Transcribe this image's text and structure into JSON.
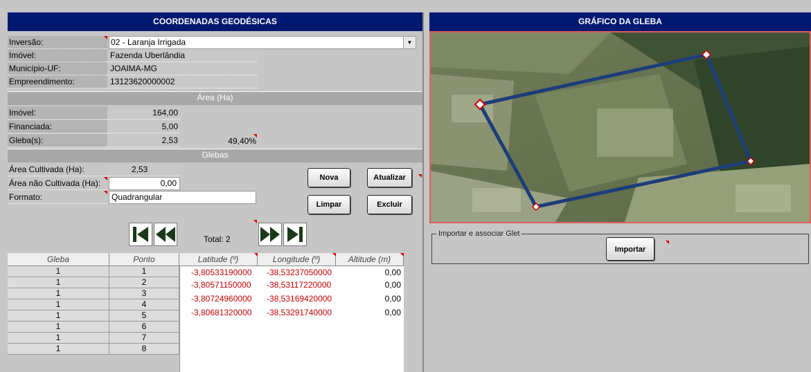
{
  "left_header": "COORDENADAS GEODÉSICAS",
  "right_header": "GRÁFICO DA GLEBA",
  "fields": {
    "inversao": {
      "label": "Inversão:",
      "value": "02 - Laranja Irrigada"
    },
    "imovel": {
      "label": "Imóvel:",
      "value": "Fazenda Uberlândia"
    },
    "municipio": {
      "label": "Município-UF:",
      "value": "JOAIMA-MG"
    },
    "empreendimento": {
      "label": "Empreendimento:",
      "value": "13123620000002"
    }
  },
  "area_section": {
    "title": "Área (Ha)",
    "imovel": {
      "label": "Imóvel:",
      "value": "164,00"
    },
    "financiada": {
      "label": "Financiada:",
      "value": "5,00"
    },
    "glebas": {
      "label": "Gleba(s):",
      "value": "2,53",
      "percent": "49,40%"
    }
  },
  "glebas_section": {
    "title": "Glebas",
    "area_cultivada": {
      "label": "Área Cultivada (Ha):",
      "value": "2,53"
    },
    "area_nao_cultivada": {
      "label": "Área não Cultivada (Ha):",
      "value": "0,00"
    },
    "formato": {
      "label": "Formato:",
      "value": "Quadrangular"
    }
  },
  "buttons": {
    "nova": "Nova",
    "atualizar": "Atualizar",
    "limpar": "Limpar",
    "excluir": "Excluir",
    "importar": "Importar"
  },
  "total_label": "Total: 2",
  "import_group_label": "Importar e associar Glet",
  "table": {
    "headers": [
      "Gleba",
      "Ponto",
      "Latitude (º)",
      "Longitude (º)",
      "Altitude (m)"
    ],
    "rows": [
      [
        "1",
        "1",
        "-3,80533190000",
        "-38,53237050000",
        "0,00"
      ],
      [
        "1",
        "2",
        "-3,80571150000",
        "-38,53117220000",
        "0,00"
      ],
      [
        "1",
        "3",
        "-3,80724960000",
        "-38,53169420000",
        "0,00"
      ],
      [
        "1",
        "4",
        "-3,80681320000",
        "-38,53291740000",
        "0,00"
      ],
      [
        "1",
        "5",
        "",
        "",
        ""
      ],
      [
        "1",
        "6",
        "",
        "",
        ""
      ],
      [
        "1",
        "7",
        "",
        "",
        ""
      ],
      [
        "1",
        "8",
        "",
        "",
        ""
      ]
    ]
  },
  "colors": {
    "header": "#001870",
    "accent_red": "#c80000",
    "polygon": "#1c3d7a"
  }
}
